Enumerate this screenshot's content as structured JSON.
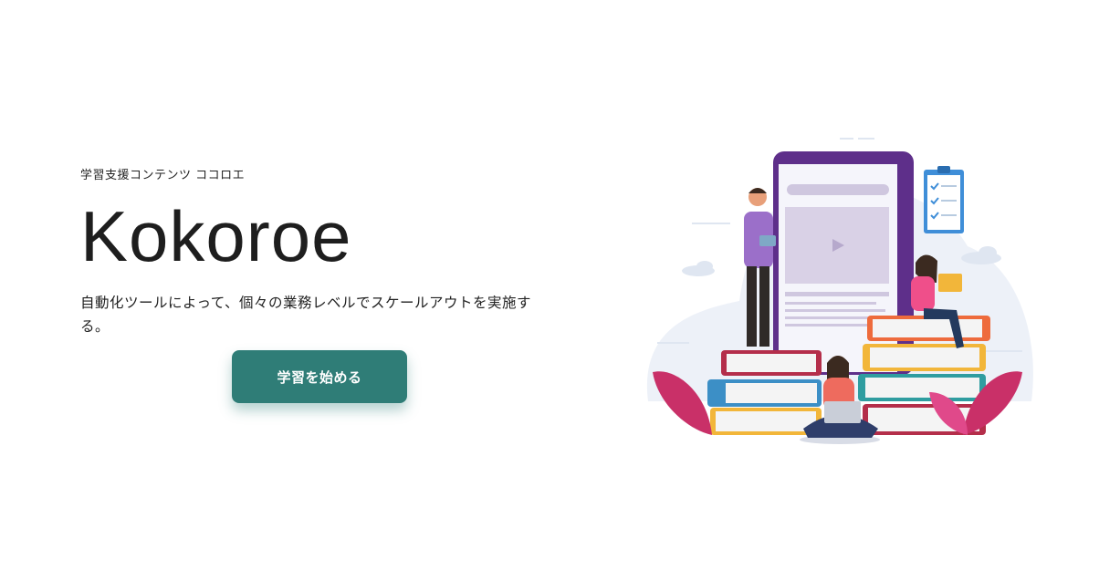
{
  "hero": {
    "eyebrow": "学習支援コンテンツ ココロエ",
    "title": "Kokoroe",
    "description": "自動化ツールによって、個々の業務レベルでスケールアウトを実施する。",
    "cta_label": "学習を始める"
  },
  "colors": {
    "primary": "#2f7d77",
    "background": "#ffffff",
    "text": "#222222"
  },
  "illustration": {
    "icon": "study-illustration"
  }
}
